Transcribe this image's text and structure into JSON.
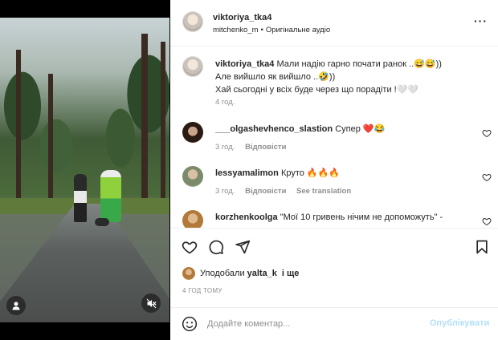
{
  "post": {
    "author": "viktoriya_tka4",
    "audio_user": "mitchenko_m",
    "audio_label": "Оригінальне аудіо"
  },
  "caption": {
    "username": "viktoriya_tka4",
    "line1": "Мали надію гарно почати ранок ..😅😅))",
    "line2": "Але вийшло як вийшло ..🤣))",
    "line3": "Хай сьогодні у всіх буде через що порадіти !🤍🤍",
    "time": "4 год."
  },
  "comments": [
    {
      "username": "___olgashevhenco_slastion",
      "text": "Супер ❤️😂",
      "time": "3 год.",
      "reply_label": "Відповісти",
      "translate_label": ""
    },
    {
      "username": "lessyamalimon",
      "text": "Круто 🔥🔥🔥",
      "time": "3 год.",
      "reply_label": "Відповісти",
      "translate_label": "See translation"
    },
    {
      "username": "korzhenkoolga",
      "text": "\"Мої 10 гривень нічим не допоможуть\" -",
      "time": "",
      "reply_label": "",
      "translate_label": ""
    }
  ],
  "likes": {
    "prefix": "Уподобали",
    "user": "yalta_k",
    "suffix": "і ще"
  },
  "time_ago": "4 ГОД ТОМУ",
  "composer": {
    "placeholder": "Додайте коментар...",
    "post_label": "Опублікувати"
  },
  "colors": {
    "heart_red": "#ed4956",
    "link_blue_disabled": "#b2dffc",
    "meta_gray": "#8e8e8e"
  }
}
